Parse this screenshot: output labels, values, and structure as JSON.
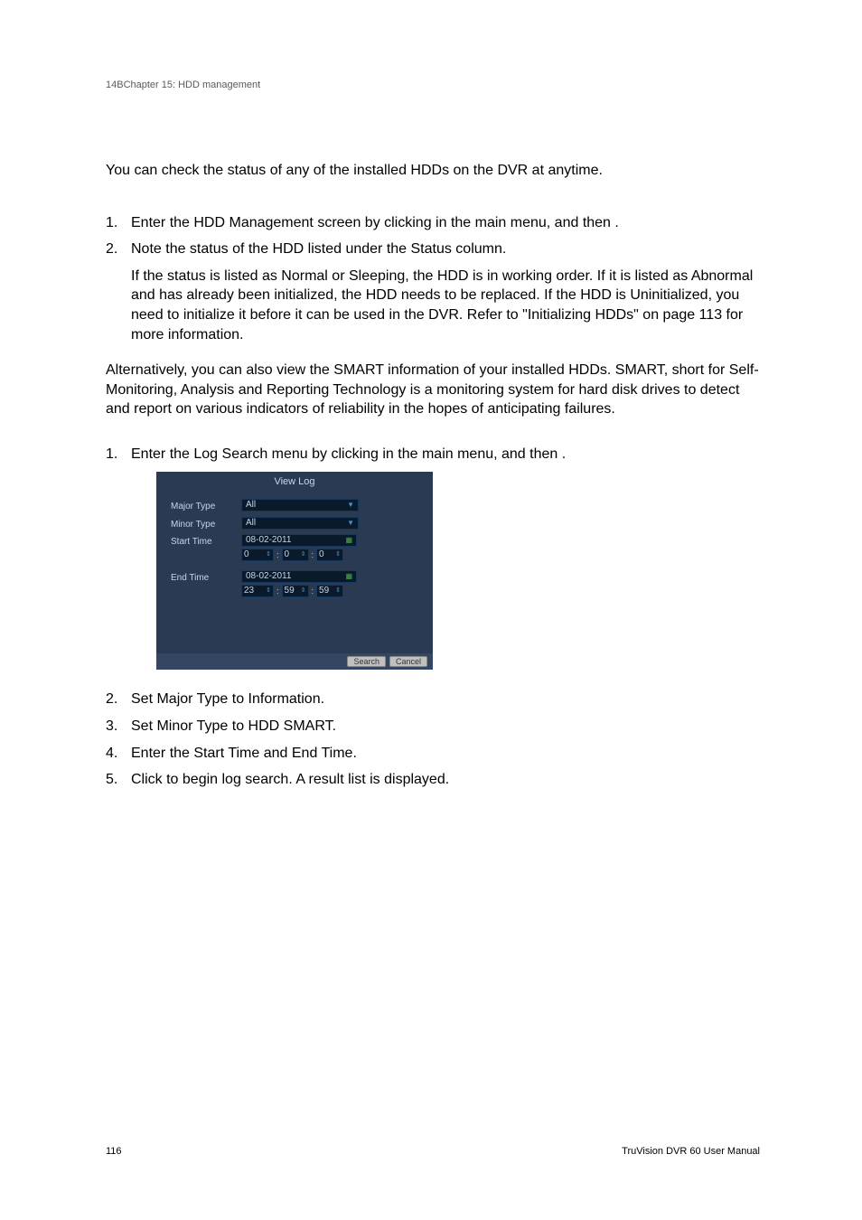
{
  "header": {
    "chapter_label": "14BChapter 15: HDD management"
  },
  "intro": {
    "text": "You can check the status of any of the installed HDDs on the DVR at anytime."
  },
  "steps_a": [
    {
      "num": "1.",
      "parts": {
        "p1": "Enter the HDD Management screen by clicking ",
        "p2": " in the main menu, and then ",
        "p3": "."
      }
    },
    {
      "num": "2.",
      "parts": {
        "p1": "Note the status of the HDD listed under the Status column."
      },
      "sub": "If the status is listed as Normal or Sleeping, the HDD is in working order. If it is listed as Abnormal and has already been initialized, the HDD needs to be replaced. If the HDD is Uninitialized, you need to initialize it before it can be used in the DVR. Refer to \"Initializing HDDs\" on page 113 for more information."
    }
  ],
  "alt_para": "Alternatively, you can also view the SMART information of your installed HDDs. SMART, short for Self-Monitoring, Analysis and Reporting Technology is a monitoring system for hard disk drives to detect and report on various indicators of reliability in the hopes of anticipating failures.",
  "steps_b": [
    {
      "num": "1.",
      "parts": {
        "p1": "Enter the Log Search menu by clicking ",
        "p2": " in the main menu, and then ",
        "p3": "."
      }
    },
    {
      "num": "2.",
      "parts": {
        "p1": "Set Major Type to Information."
      }
    },
    {
      "num": "3.",
      "parts": {
        "p1": "Set Minor Type to HDD SMART."
      }
    },
    {
      "num": "4.",
      "parts": {
        "p1": "Enter the Start Time and End Time."
      }
    },
    {
      "num": "5.",
      "parts": {
        "p1": "Click ",
        "p2": " to begin log search. A result list is displayed."
      }
    }
  ],
  "dialog": {
    "title": "View Log",
    "labels": {
      "major": "Major Type",
      "minor": "Minor Type",
      "start": "Start Time",
      "end": "End Time"
    },
    "values": {
      "major": "All",
      "minor": "All",
      "start_date": "08-02-2011",
      "start_h": "0",
      "start_m": "0",
      "start_s": "0",
      "end_date": "08-02-2011",
      "end_h": "23",
      "end_m": "59",
      "end_s": "59"
    },
    "buttons": {
      "search": "Search",
      "cancel": "Cancel"
    }
  },
  "footer": {
    "page": "116",
    "doc": "TruVision DVR 60 User Manual"
  }
}
